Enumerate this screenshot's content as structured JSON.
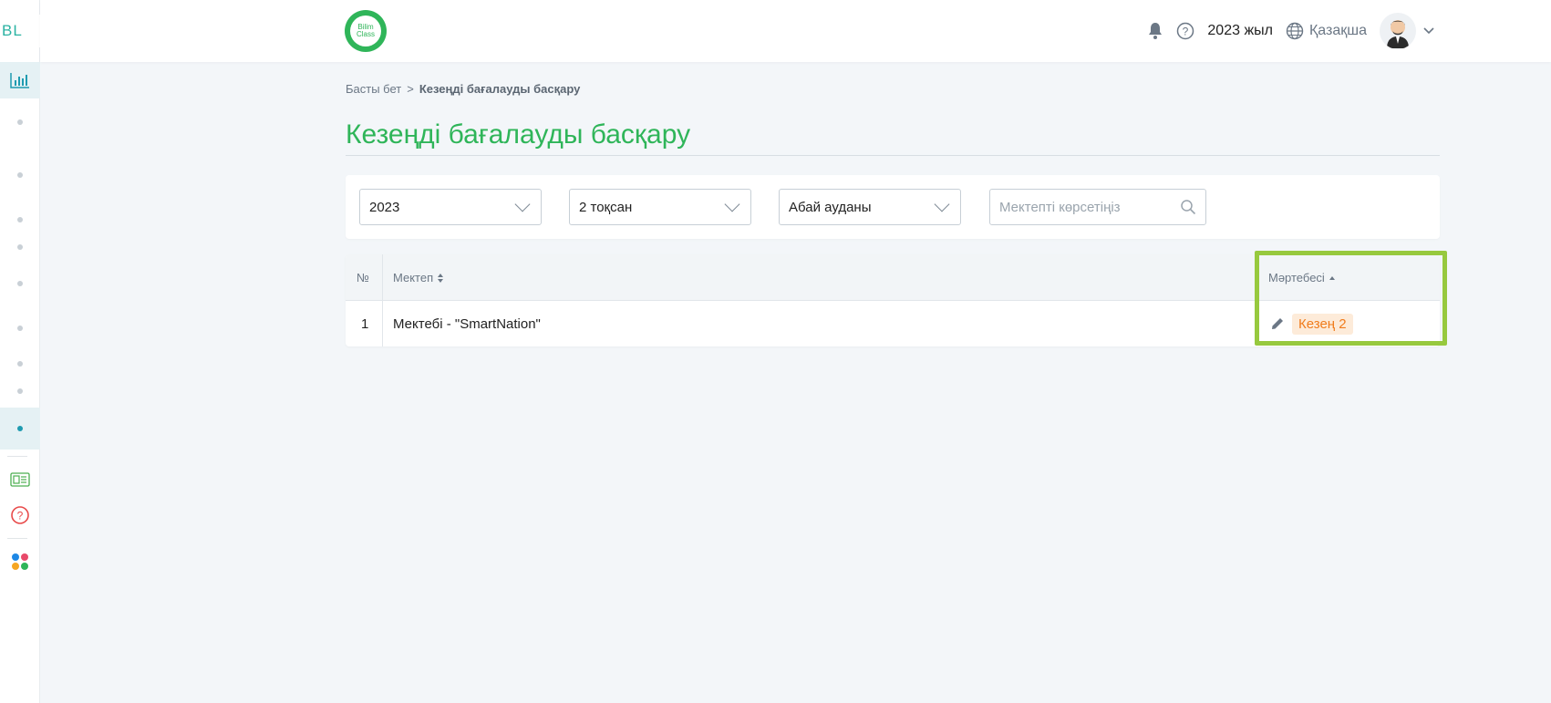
{
  "sidebar": {
    "logo_text": "BL",
    "toggle_icon": "chevron-right-icon"
  },
  "header": {
    "brand_line1": "Bilim",
    "brand_line2": "Class",
    "year_label": "2023 жыл",
    "language": "Қазақша"
  },
  "breadcrumb": {
    "home": "Басты бет",
    "separator": ">",
    "current": "Кезеңді бағалауды басқару"
  },
  "page": {
    "title": "Кезеңді бағалауды басқару"
  },
  "filters": {
    "year": "2023",
    "quarter": "2 тоқсан",
    "district": "Абай ауданы",
    "search_placeholder": "Мектепті көрсетіңіз"
  },
  "table": {
    "col_number": "№",
    "col_school": "Мектеп",
    "col_status": "Мәртебесі",
    "rows": [
      {
        "number": "1",
        "school": "Мектебі - \"SmartNation\"",
        "status": "Кезең 2"
      }
    ]
  },
  "colors": {
    "brand_green": "#2fb559",
    "accent_teal": "#1e9bb0",
    "status_orange": "#f07c1c",
    "highlight": "#97c93e"
  }
}
